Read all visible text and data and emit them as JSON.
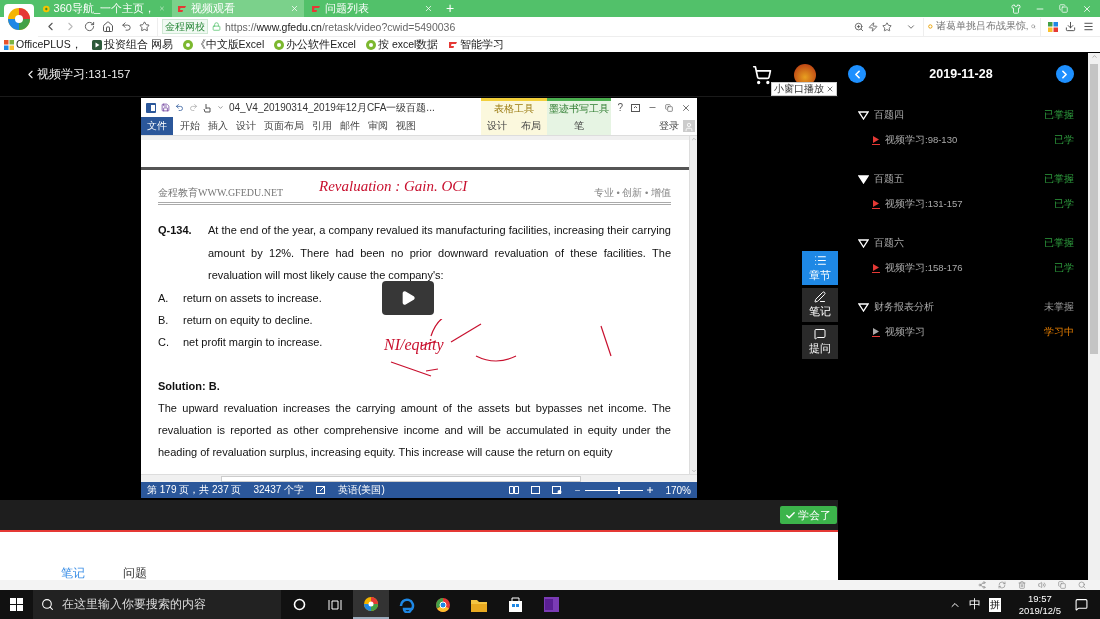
{
  "browser": {
    "tabs": [
      {
        "title": "360导航_一个主页，",
        "selected": false
      },
      {
        "title": "视频观看",
        "selected": true
      },
      {
        "title": "问题列表",
        "selected": false
      }
    ],
    "new_tab": "+",
    "site_badge": "金程网校",
    "url": "https://**www.gfedu.cn**/retask/video?cwid=5490036",
    "search_placeholder": "诸葛单挑吕布战果惊,",
    "bookmarks": [
      "OfficePLUS，",
      "投资组合 网易",
      "《中文版Excel",
      "办公软件Excel",
      "按 excel数据",
      "智能学习"
    ]
  },
  "player": {
    "back_title": "视频学习:131-157",
    "mini_window": "小窗口播放",
    "word": {
      "title": "04_V4_20190314_2019年12月CFA一级百题...",
      "ribbon_tabs": [
        {
          "label": "文件",
          "selected": true
        },
        {
          "label": "开始",
          "selected": false
        },
        {
          "label": "插入",
          "selected": false
        },
        {
          "label": "设计",
          "selected": false
        },
        {
          "label": "页面布局",
          "selected": false
        },
        {
          "label": "引用",
          "selected": false
        },
        {
          "label": "邮件",
          "selected": false
        },
        {
          "label": "审阅",
          "selected": false
        },
        {
          "label": "视图",
          "selected": false
        }
      ],
      "context_groups": [
        {
          "label": "表格工具",
          "kind": "table",
          "tabs": [
            "设计",
            "布局"
          ]
        },
        {
          "label": "墨迹书写工具",
          "kind": "ink",
          "tabs": [
            "笔"
          ]
        }
      ],
      "help": "?",
      "login": "登录",
      "doc": {
        "header_left": "金程教育WWW.GFEDU.NET",
        "header_right": "专业 • 创新 • 增值",
        "question_number": "Q-134.",
        "question": "At the end of the year, a company revalued its manufacturing facilities, increasing their carrying amount by 12%. There had been no prior downward revaluation of these facilities. The revaluation will most likely cause the company's:",
        "options": [
          {
            "letter": "A.",
            "text": "return on assets to increase."
          },
          {
            "letter": "B.",
            "text": "return on equity to decline."
          },
          {
            "letter": "C.",
            "text": "net profit margin to increase."
          }
        ],
        "solution_label": "Solution: B.",
        "solution": "The upward revaluation increases the carrying amount of the assets but bypasses net income. The revaluation is reported as other comprehensive income and will be accumulated in equity under the heading of revaluation surplus, increasing equity. This increase will cause the return on equity",
        "handwriting": [
          "Revaluation : Gain. OCI",
          "NI/equity"
        ]
      },
      "status": {
        "page": "第 179 页，共 237 页",
        "words": "32437 个字",
        "language": "英语(美国)",
        "zoom": "170%",
        "zoom_slider": {
          "level": 0.57
        }
      }
    },
    "side_tools": [
      {
        "label": "章节",
        "selected": true
      },
      {
        "label": "笔记",
        "selected": false
      },
      {
        "label": "提问",
        "selected": false
      }
    ],
    "learned_button": "学会了",
    "bottom_tabs": [
      {
        "label": "笔记",
        "selected": true
      },
      {
        "label": "问题",
        "selected": false
      }
    ]
  },
  "sidebar": {
    "date": "2019-11-28",
    "chapters": [
      {
        "title": "百题四",
        "status": "已掌握",
        "kind": "done",
        "selected": false,
        "children": [
          {
            "title": "视频学习:98-130",
            "status": "已学",
            "kind": "done"
          }
        ]
      },
      {
        "title": "百题五",
        "status": "已掌握",
        "kind": "done",
        "selected": true,
        "children": [
          {
            "title": "视频学习:131-157",
            "status": "已学",
            "kind": "done"
          }
        ]
      },
      {
        "title": "百题六",
        "status": "已掌握",
        "kind": "done",
        "selected": false,
        "children": [
          {
            "title": "视频学习:158-176",
            "status": "已学",
            "kind": "done"
          }
        ]
      },
      {
        "title": "财务报表分析",
        "status": "未掌握",
        "kind": "todo",
        "selected": false,
        "children": [
          {
            "title": "视频学习",
            "status": "学习中",
            "kind": "active"
          }
        ]
      }
    ]
  },
  "taskbar": {
    "search_placeholder": "在这里输入你要搜索的内容",
    "ime": "中",
    "ime_mode": "拼",
    "time": "19:57",
    "date": "2019/12/5"
  }
}
